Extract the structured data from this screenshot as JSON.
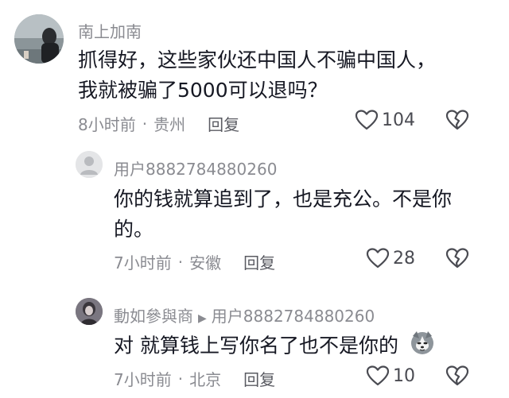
{
  "comments": [
    {
      "username": "南上加南",
      "text_line1": "抓得好，这些家伙还中国人不骗中国人，",
      "text_line2": "我就被骗了5000可以退吗？",
      "time": "8小时前",
      "location": "贵州",
      "reply_label": "回复",
      "likes": "104"
    },
    {
      "username": "用户8882784880260",
      "text_line1": "你的钱就算追到了，也是充公。不是你",
      "text_line2": "的。",
      "time": "7小时前",
      "location": "安徽",
      "reply_label": "回复",
      "likes": "28"
    },
    {
      "username": "動如參與商",
      "reply_to": "用户8882784880260",
      "text_line1": "对 就算钱上写你名了也不是你的",
      "time": "7小时前",
      "location": "北京",
      "reply_label": "回复",
      "likes": "10"
    }
  ],
  "separator": "·",
  "icons": {
    "like": "heart-outline-icon",
    "dislike": "broken-heart-icon",
    "reply_arrow": "triangle-right-icon"
  }
}
